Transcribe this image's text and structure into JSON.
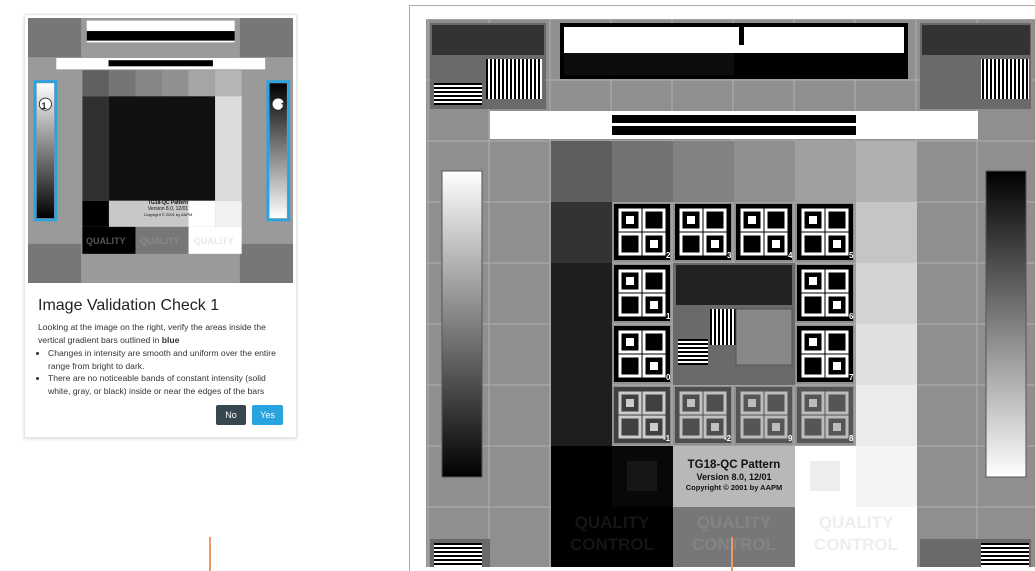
{
  "card": {
    "title": "Image Validation Check 1",
    "intro": "Looking at the image on the right, verify the areas inside the vertical gradient bars outlined in",
    "intro_emphasis": "blue",
    "bullets": [
      "Changes in intensity are smooth and uniform over the entire range from bright to dark.",
      "There are no noticeable bands of constant intensity (solid white, gray, or black) inside or near the edges of the bars"
    ],
    "no_label": "No",
    "yes_label": "Yes",
    "marker_left": "1",
    "marker_right": "1"
  },
  "pattern": {
    "name": "TG18-QC Pattern",
    "version": "Version 8.0, 12/01",
    "copyright": "Copyright © 2001 by AAPM",
    "quality_word": "QUALITY",
    "control_word": "CONTROL",
    "letter_labels": [
      "2",
      "3",
      "4",
      "5",
      "1",
      "6",
      "0",
      "7",
      "-1",
      "-2",
      "9",
      "8"
    ]
  },
  "colors": {
    "button_no": "#37474f",
    "button_yes": "#29a3df",
    "highlight_outline": "#29a3df",
    "cursor_line": "#ee9966"
  }
}
